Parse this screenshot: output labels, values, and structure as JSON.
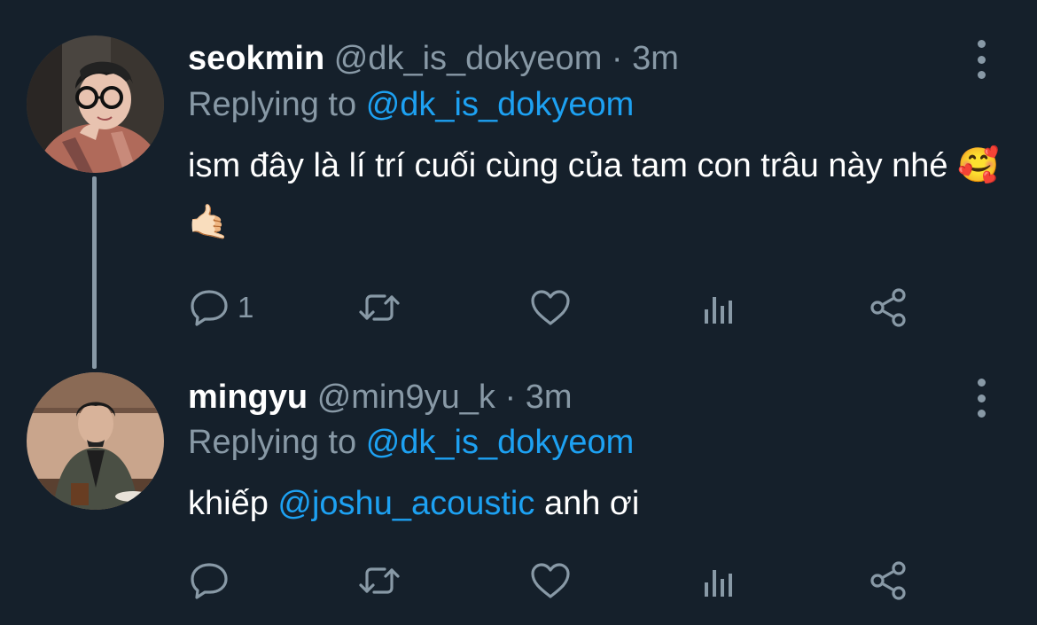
{
  "colors": {
    "background": "#15202b",
    "secondary_text": "#8899a6",
    "link": "#1da1f2",
    "primary_text": "#ffffff"
  },
  "tweets": [
    {
      "name": "seokmin",
      "handle": "@dk_is_dokyeom",
      "separator": "·",
      "time": "3m",
      "replying_prefix": "Replying to",
      "replying_to": "@dk_is_dokyeom",
      "text": "ism đây là lí trí cuối cùng của tam con trâu này nhé 🥰 🤙🏻",
      "reply_count": "1",
      "icons": [
        "reply-icon",
        "retweet-icon",
        "like-icon",
        "stats-icon",
        "share-icon"
      ]
    },
    {
      "name": "mingyu",
      "handle": "@min9yu_k",
      "separator": "·",
      "time": "3m",
      "replying_prefix": "Replying to",
      "replying_to": "@dk_is_dokyeom",
      "text_before": "khiếp",
      "mention": "@joshu_acoustic",
      "text_after": "anh ơi",
      "reply_count": "",
      "icons": [
        "reply-icon",
        "retweet-icon",
        "like-icon",
        "stats-icon",
        "share-icon"
      ]
    }
  ]
}
